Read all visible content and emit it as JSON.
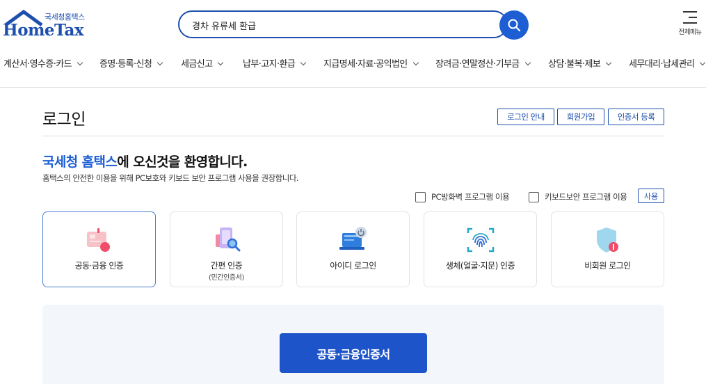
{
  "header": {
    "logo_small": "국세청홈택스",
    "logo_big": "HomeTax",
    "search_value": "경차 유류세 환급",
    "menu_label": "전체메뉴"
  },
  "gnb": {
    "items": [
      {
        "label": "계산서·영수증·카드"
      },
      {
        "label": "증명·등록·신청"
      },
      {
        "label": "세금신고"
      },
      {
        "label": "납부·고지·환급"
      },
      {
        "label": "지급명세·자료·공익법인"
      },
      {
        "label": "장려금·연말정산·기부금"
      },
      {
        "label": "상담·불복·제보"
      },
      {
        "label": "세무대리·납세관리"
      }
    ]
  },
  "page": {
    "title": "로그인",
    "buttons": {
      "login_guide": "로그인 안내",
      "signup": "회원가입",
      "cert_register": "인증서 등록"
    },
    "welcome_brand": "국세청 홈택스",
    "welcome_rest": "에 오신것을 환영합니다.",
    "subtext": "홈택스의 안전한 이용을 위해 PC보호와 키보드 보안 프로그램 사용을 권장합니다.",
    "options": {
      "pc_firewall": "PC방화벽 프로그램 이용",
      "keyboard_security": "키보드보안 프로그램 이용",
      "use_button": "사용"
    }
  },
  "login_methods": [
    {
      "label": "공동·금융 인증",
      "sub": "",
      "icon": "certificate-card-icon",
      "active": true
    },
    {
      "label": "간편 인증",
      "sub": "(민간인증서)",
      "icon": "mobile-search-icon",
      "active": false
    },
    {
      "label": "아이디 로그인",
      "sub": "",
      "icon": "laptop-power-icon",
      "active": false
    },
    {
      "label": "생체(얼굴·지문) 인증",
      "sub": "",
      "icon": "fingerprint-icon",
      "active": false
    },
    {
      "label": "비회원 로그인",
      "sub": "",
      "icon": "shield-key-icon",
      "active": false
    }
  ],
  "panel": {
    "main_button": "공동·금융인증서"
  },
  "colors": {
    "brand": "#1d4fae",
    "accent": "#1d54c9",
    "panel_bg": "#f3f6fb"
  }
}
